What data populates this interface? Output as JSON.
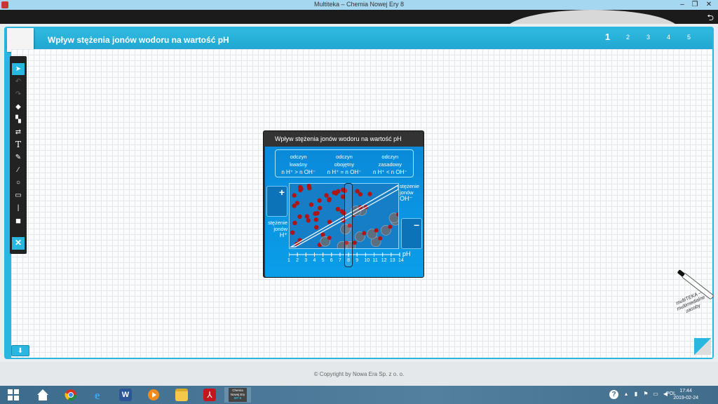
{
  "window": {
    "title": "Multiteka – Chemia Nowej Ery 8",
    "controls": [
      "–",
      "❐",
      "✕"
    ]
  },
  "header": {
    "back_icon": "back-arrow-icon",
    "page_title": "Wpływ stężenia jonów wodoru na wartość pH",
    "pages": [
      "1",
      "2",
      "3",
      "4",
      "5"
    ],
    "active_page": "1"
  },
  "toolbar": {
    "tools": [
      {
        "name": "select",
        "glyph": "➤"
      },
      {
        "name": "undo",
        "glyph": "↶"
      },
      {
        "name": "redo",
        "glyph": "↷"
      },
      {
        "name": "eraser",
        "glyph": "◆"
      },
      {
        "name": "layers",
        "glyph": "▚"
      },
      {
        "name": "swap",
        "glyph": "⇄"
      },
      {
        "name": "text",
        "glyph": "T"
      },
      {
        "name": "highlighter",
        "glyph": "✎"
      },
      {
        "name": "pen",
        "glyph": "∕"
      },
      {
        "name": "circle",
        "glyph": "○"
      },
      {
        "name": "rectangle",
        "glyph": "▭"
      },
      {
        "name": "line",
        "glyph": "|"
      },
      {
        "name": "color",
        "glyph": "■"
      }
    ],
    "close_glyph": "✕",
    "download_glyph": "⬇"
  },
  "widget": {
    "title": "Wpływ stężenia jonów wodoru na wartość pH",
    "types": [
      {
        "line1": "odczyn",
        "line2": "kwaśny",
        "relation": "n H⁺ > n OH⁻"
      },
      {
        "line1": "odczyn",
        "line2": "obojętny",
        "relation": "n H⁺ = n OH⁻"
      },
      {
        "line1": "odczyn",
        "line2": "zasadowy",
        "relation": "n H⁺ < n OH⁻"
      }
    ],
    "plus_label": "+",
    "minus_label": "–",
    "label_oh_line1": "stężenie",
    "label_oh_line2": "jonów",
    "label_oh_line3": "OH⁻",
    "label_h_line1": "stężenie",
    "label_h_line2": "jonów",
    "label_h_line3": "H⁺",
    "ph_label": "pH",
    "ph_ticks": [
      "1",
      "2",
      "3",
      "4",
      "5",
      "6",
      "7",
      "8",
      "9",
      "10",
      "11",
      "12",
      "13",
      "14"
    ],
    "selected_ph": 8
  },
  "footer": {
    "copyright": "© Copyright by Nowa Era Sp. z o. o."
  },
  "brand_deco": "multiTEKA – multimedialne zasoby",
  "taskbar": {
    "apps": [
      "start",
      "home",
      "chrome",
      "internet-explorer",
      "word",
      "media-player",
      "file-explorer",
      "acrobat",
      "multiteka"
    ],
    "active_app": "multiteka",
    "multiteka_label_line1": "Chemia",
    "multiteka_label_line2": "Nowej Ery",
    "multiteka_label_line3": "MT 8",
    "language": "POL",
    "time": "17:44",
    "date": "2019-02-24"
  },
  "colors": {
    "accent": "#29b7df",
    "widget_blue": "#0a8ad9",
    "ion_red": "#b01515",
    "ion_gray": "#5b6f80"
  }
}
